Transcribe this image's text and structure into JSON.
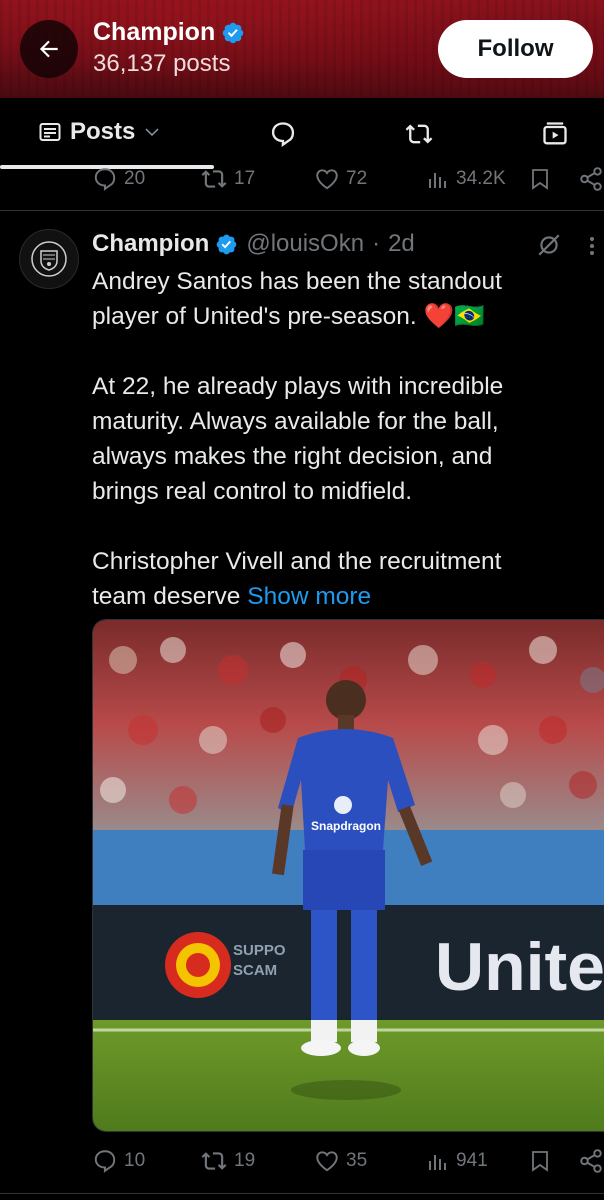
{
  "header": {
    "name": "Champion",
    "posts_count": "36,137 posts",
    "follow_label": "Follow"
  },
  "tabs": {
    "posts_label": "Posts"
  },
  "prev_post_stats": {
    "replies": "20",
    "reposts": "17",
    "likes": "72",
    "views": "34.2K"
  },
  "tweet": {
    "display_name": "Champion",
    "handle": "@louisOkn",
    "separator": "·",
    "age": "2d",
    "text": "Andrey Santos has been the standout player of United's pre-season. ❤️🇧🇷\n\nAt 22, he already plays with incredible maturity. Always available for the ball, always makes the right decision, and brings real control to midfield.\n\nChristopher Vivell and the recruitment team deserve ",
    "show_more": "Show more",
    "media": {
      "sponsor_text": "Snapdragon",
      "board_text": "Unite",
      "board_small_text": "SUPPO\nSCAM"
    },
    "stats": {
      "replies": "10",
      "reposts": "19",
      "likes": "35",
      "views": "941"
    }
  },
  "colors": {
    "accent": "#1d9bf0",
    "muted": "#71767b",
    "banner": "#8a121c",
    "verified": "#1d9bf0"
  }
}
